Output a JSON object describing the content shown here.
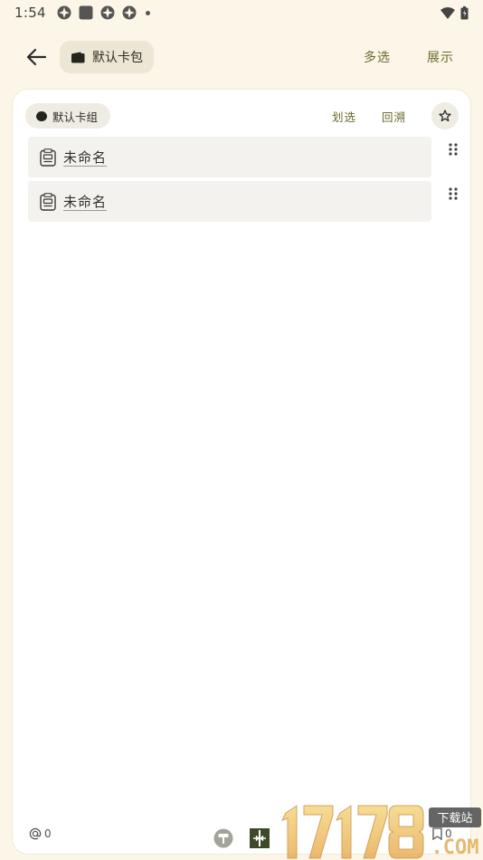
{
  "status_bar": {
    "time": "1:54"
  },
  "top_bar": {
    "wallet_label": "默认卡包",
    "multi_select_label": "多选",
    "display_label": "展示"
  },
  "card_group": {
    "group_label": "默认卡组",
    "swipe_select_label": "划选",
    "trace_back_label": "回溯"
  },
  "cards": [
    {
      "title": "未命名",
      "icon": "note-card-icon"
    },
    {
      "title": "未命名",
      "icon": "note-card-icon"
    }
  ],
  "bottom_bar": {
    "mention_count": "0",
    "bookmark_count": "0"
  },
  "watermark": {
    "text": "17178",
    "badge": "下载站",
    "suffix": ".COM"
  },
  "colors": {
    "background": "#fbf6e8",
    "accent": "#6b6a2e",
    "chip": "#ece6d4",
    "card_item": "#f3f2ee"
  }
}
